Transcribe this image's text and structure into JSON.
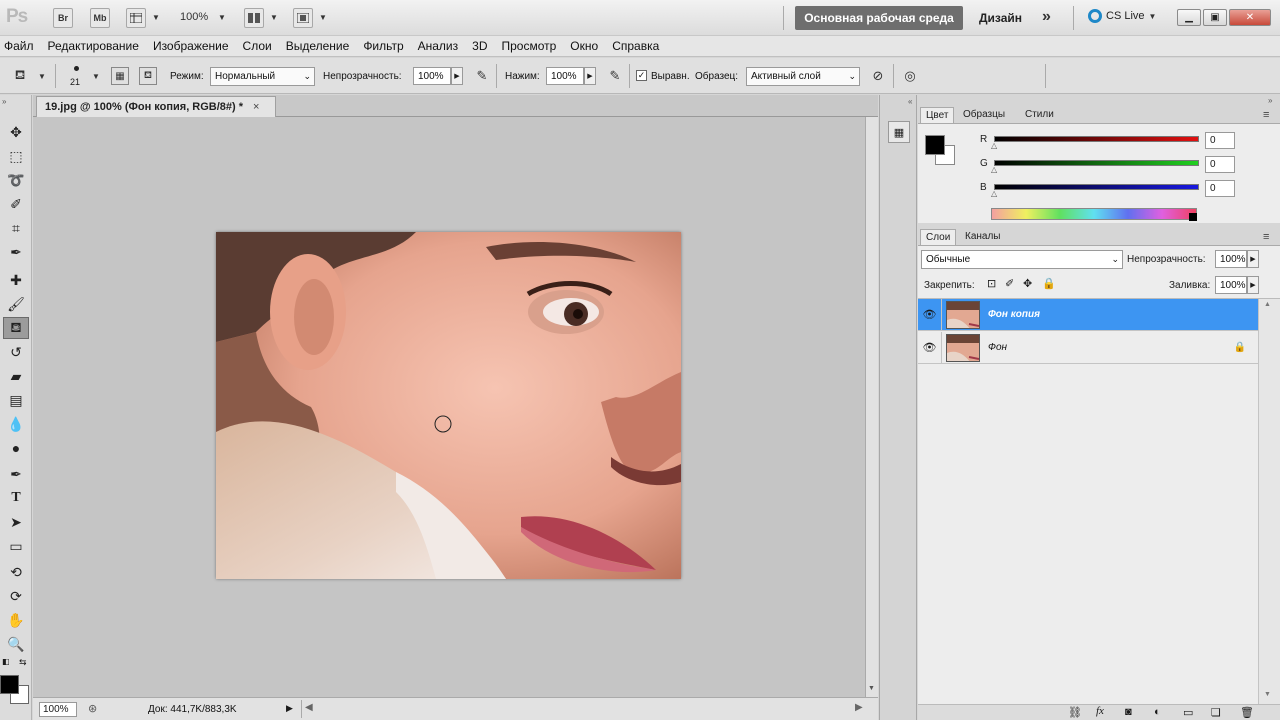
{
  "appbar": {
    "logo": "Ps",
    "br": "Br",
    "mb": "Mb",
    "zoom": "100%",
    "workspace_active": "Основная рабочая среда",
    "workspace_design": "Дизайн",
    "more": "»",
    "cslive": "CS Live"
  },
  "menu": [
    "Файл",
    "Редактирование",
    "Изображение",
    "Слои",
    "Выделение",
    "Фильтр",
    "Анализ",
    "3D",
    "Просмотр",
    "Окно",
    "Справка"
  ],
  "options": {
    "brush_size": "21",
    "mode_label": "Режим:",
    "mode_value": "Нормальный",
    "opacity_label": "Непрозрачность:",
    "opacity_value": "100%",
    "flow_label": "Нажим:",
    "flow_value": "100%",
    "aligned_label": "Выравн.",
    "aligned_checked": "✓",
    "sample_label": "Образец:",
    "sample_value": "Активный слой"
  },
  "document": {
    "tab_title": "19.jpg @ 100% (Фон копия, RGB/8#) *",
    "close": "×",
    "zoom": "100%",
    "doc_info": "Док: 441,7K/883,3K"
  },
  "color_panel": {
    "tabs": [
      "Цвет",
      "Образцы",
      "Стили"
    ],
    "channels": [
      {
        "label": "R",
        "value": "0",
        "color": "#e21010"
      },
      {
        "label": "G",
        "value": "0",
        "color": "#20d020"
      },
      {
        "label": "B",
        "value": "0",
        "color": "#1818e0"
      }
    ]
  },
  "layers_panel": {
    "tabs": [
      "Слои",
      "Каналы"
    ],
    "blend_mode": "Обычные",
    "opacity_label": "Непрозрачность:",
    "opacity_value": "100%",
    "lock_label": "Закрепить:",
    "fill_label": "Заливка:",
    "fill_value": "100%",
    "layers": [
      {
        "name": "Фон копия",
        "active": true,
        "locked": false
      },
      {
        "name": "Фон",
        "active": false,
        "locked": true
      }
    ]
  },
  "icons": {
    "tools": [
      "move-icon",
      "marquee-icon",
      "lasso-icon",
      "quick-select-icon",
      "crop-icon",
      "eyedropper-icon",
      "healing-brush-icon",
      "brush-icon",
      "clone-stamp-icon",
      "history-brush-icon",
      "eraser-icon",
      "gradient-icon",
      "blur-icon",
      "dodge-icon",
      "pen-icon",
      "type-icon",
      "path-select-icon",
      "shape-icon",
      "3d-rotate-icon",
      "3d-orbit-icon",
      "hand-icon",
      "zoom-icon"
    ]
  }
}
